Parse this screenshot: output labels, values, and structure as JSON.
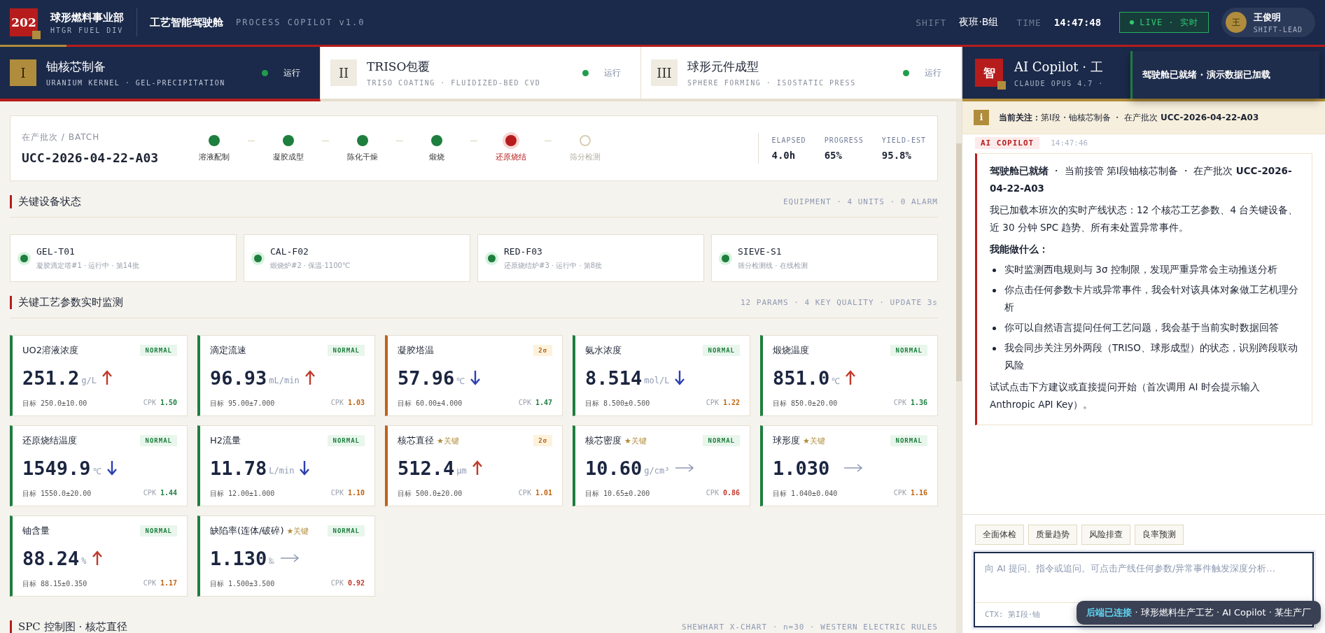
{
  "header": {
    "logo": "202",
    "org": "球形燃料事业部",
    "org_sub": "HTGR FUEL DIV",
    "app": "工艺智能驾驶舱",
    "app_sub": "PROCESS COPILOT v1.0",
    "shift_label": "SHIFT",
    "shift": "夜班·B组",
    "time_label": "TIME",
    "time": "14:47:48",
    "live": {
      "label": "LIVE · 实时",
      "on": true
    },
    "user": {
      "avatar": "王",
      "name": "王俊明",
      "role": "SHIFT-LEAD"
    }
  },
  "stages": [
    {
      "numeral": "I",
      "title": "铀核芯制备",
      "subtitle": "URANIUM KERNEL · GEL-PRECIPITATION",
      "status": "运行",
      "running": true,
      "selected": true
    },
    {
      "numeral": "II",
      "title": "TRISO包覆",
      "subtitle": "TRISO COATING · FLUIDIZED-BED CVD",
      "status": "运行",
      "running": true,
      "selected": false
    },
    {
      "numeral": "III",
      "title": "球形元件成型",
      "subtitle": "SPHERE FORMING · ISOSTATIC PRESS",
      "status": "运行",
      "running": true,
      "selected": false
    }
  ],
  "batch": {
    "label": "在产批次 / BATCH",
    "id": "UCC-2026-04-22-A03",
    "steps": [
      {
        "label": "溶液配制",
        "done": true,
        "current": false
      },
      {
        "label": "凝胶成型",
        "done": true,
        "current": false
      },
      {
        "label": "陈化干燥",
        "done": true,
        "current": false
      },
      {
        "label": "煅烧",
        "done": true,
        "current": false
      },
      {
        "label": "还原烧结",
        "done": false,
        "current": true
      },
      {
        "label": "筛分检测",
        "done": false,
        "current": false
      }
    ],
    "stats": [
      {
        "label": "ELAPSED",
        "value": "4.0h"
      },
      {
        "label": "PROGRESS",
        "value": "65%"
      },
      {
        "label": "YIELD-EST",
        "value": "95.8%"
      }
    ]
  },
  "equipment_section": {
    "title": "关键设备状态",
    "meta": "EQUIPMENT · 4 UNITS · 0 ALARM"
  },
  "equipment": [
    {
      "name": "GEL-T01",
      "detail": "凝胶滴定塔#1 · 运行中 · 第14批",
      "running": true
    },
    {
      "name": "CAL-F02",
      "detail": "煅烧炉#2 · 保温·1100℃",
      "running": true
    },
    {
      "name": "RED-F03",
      "detail": "还原烧结炉#3 · 运行中 · 第8批",
      "running": true
    },
    {
      "name": "SIEVE-S1",
      "detail": "筛分检测线 · 在线检测",
      "running": true
    }
  ],
  "params_section": {
    "title": "关键工艺参数实时监测",
    "meta": "12 PARAMS · 4 KEY QUALITY · UPDATE 3s"
  },
  "params": [
    {
      "name": "UO2溶液浓度",
      "alert": false,
      "badge": "NORMAL",
      "value": "251.2",
      "unit": "g/L",
      "trend": {
        "kind": "up"
      },
      "target": "目标 250.0±10.00",
      "cpk_label": "CPK",
      "cpk": {
        "value": "1.50",
        "color": "#1e7e3e"
      }
    },
    {
      "name": "滴定流速",
      "alert": false,
      "badge": "NORMAL",
      "value": "96.93",
      "unit": "mL/min",
      "trend": {
        "kind": "up"
      },
      "target": "目标 95.00±7.000",
      "cpk_label": "CPK",
      "cpk": {
        "value": "1.03",
        "color": "#c0640f"
      }
    },
    {
      "name": "凝胶塔温",
      "alert": true,
      "badge": "2σ",
      "value": "57.96",
      "unit": "℃",
      "trend": {
        "kind": "down"
      },
      "target": "目标 60.00±4.000",
      "cpk_label": "CPK",
      "cpk": {
        "value": "1.47",
        "color": "#1e7e3e"
      }
    },
    {
      "name": "氨水浓度",
      "alert": false,
      "badge": "NORMAL",
      "value": "8.514",
      "unit": "mol/L",
      "trend": {
        "kind": "down"
      },
      "target": "目标 8.500±0.500",
      "cpk_label": "CPK",
      "cpk": {
        "value": "1.22",
        "color": "#c0640f"
      }
    },
    {
      "name": "煅烧温度",
      "alert": false,
      "badge": "NORMAL",
      "value": "851.0",
      "unit": "℃",
      "trend": {
        "kind": "up"
      },
      "target": "目标 850.0±20.00",
      "cpk_label": "CPK",
      "cpk": {
        "value": "1.36",
        "color": "#1e7e3e"
      }
    },
    {
      "name": "还原烧结温度",
      "alert": false,
      "badge": "NORMAL",
      "value": "1549.9",
      "unit": "℃",
      "trend": {
        "kind": "down"
      },
      "target": "目标 1550.0±20.00",
      "cpk_label": "CPK",
      "cpk": {
        "value": "1.44",
        "color": "#1e7e3e"
      }
    },
    {
      "name": "H2流量",
      "alert": false,
      "badge": "NORMAL",
      "value": "11.78",
      "unit": "L/min",
      "trend": {
        "kind": "down"
      },
      "target": "目标 12.00±1.000",
      "cpk_label": "CPK",
      "cpk": {
        "value": "1.10",
        "color": "#c0640f"
      }
    },
    {
      "name": "核芯直径",
      "tag": "★关键",
      "alert": true,
      "badge": "2σ",
      "value": "512.4",
      "unit": "μm",
      "trend": {
        "kind": "up"
      },
      "target": "目标 500.0±20.00",
      "cpk_label": "CPK",
      "cpk": {
        "value": "1.01",
        "color": "#c0640f"
      }
    },
    {
      "name": "核芯密度",
      "tag": "★关键",
      "alert": false,
      "badge": "NORMAL",
      "value": "10.60",
      "unit": "g/cm³",
      "trend": {
        "kind": "flat"
      },
      "target": "目标 10.65±0.200",
      "cpk_label": "CPK",
      "cpk": {
        "value": "0.86",
        "color": "#c0392b"
      }
    },
    {
      "name": "球形度",
      "tag": "★关键",
      "alert": false,
      "badge": "NORMAL",
      "value": "1.030",
      "trend": {
        "kind": "flat"
      },
      "target": "目标 1.040±0.040",
      "cpk_label": "CPK",
      "cpk": {
        "value": "1.16",
        "color": "#c0640f"
      }
    },
    {
      "name": "铀含量",
      "alert": false,
      "badge": "NORMAL",
      "value": "88.24",
      "unit": "%",
      "trend": {
        "kind": "up"
      },
      "target": "目标 88.15±0.350",
      "cpk_label": "CPK",
      "cpk": {
        "value": "1.17",
        "color": "#c0640f"
      }
    },
    {
      "name": "缺陷率(连体/破碎)",
      "tag": "★关键",
      "alert": false,
      "badge": "NORMAL",
      "value": "1.130",
      "unit": "‰",
      "trend": {
        "kind": "flat"
      },
      "target": "目标 1.500±3.500",
      "cpk_label": "CPK",
      "cpk": {
        "value": "0.92",
        "color": "#c0392b"
      }
    }
  ],
  "spc_section": {
    "title": "SPC 控制图 · 核芯直径",
    "meta": "SHEWHART X-CHART · n=30 · WESTERN ELECTRIC RULES"
  },
  "copilot": {
    "badge": "智",
    "title": "AI Copilot · 工",
    "subtitle": "CLAUDE OPUS 4.7 ·",
    "focus_icon": "i",
    "focus": "**当前关注：**第I段・铀核芯制备 ・ 在产批次 **UCC-2026-04-22-A03**",
    "message": {
      "author": "AI COPILOT",
      "time": "14:47:46",
      "intro": "**驾驶舱已就绪** ・ 当前接管 第I段铀核芯制备 ・ 在产批次 **UCC-2026-04-22-A03**",
      "loaded": "我已加载本班次的实时产线状态：12 个核芯工艺参数、4 台关键设备、近 30 分钟 SPC 趋势、所有未处置异常事件。",
      "heading": "我能做什么：",
      "bullets": [
        "实时监测西电规则与 3σ 控制限，发现严重异常会主动推送分析",
        "你点击任何参数卡片或异常事件，我会针对该具体对象做工艺机理分析",
        "你可以自然语言提问任何工艺问题，我会基于当前实时数据回答",
        "我会同步关注另外两段（TRISO、球形成型）的状态，识别跨段联动风险"
      ],
      "closing": "试试点击下方建议或直接提问开始（首次调用 AI 时会提示输入 Anthropic API Key）。"
    },
    "suggestions": [
      "全面体检",
      "质量趋势",
      "风险排查",
      "良率预测"
    ],
    "input": {
      "placeholder": "向 AI 提问、指令或追问。可点击产线任何参数/异常事件触发深度分析...",
      "context": "CTX: 第I段·铀"
    }
  },
  "toasts": [
    {
      "kind": "ready",
      "text": "驾驶舱已就绪 · 演示数据已加载"
    },
    {
      "kind": "backend",
      "text": "**后端已连接** · 球形燃料生产工艺 · AI Copilot · 某生产厂"
    }
  ]
}
